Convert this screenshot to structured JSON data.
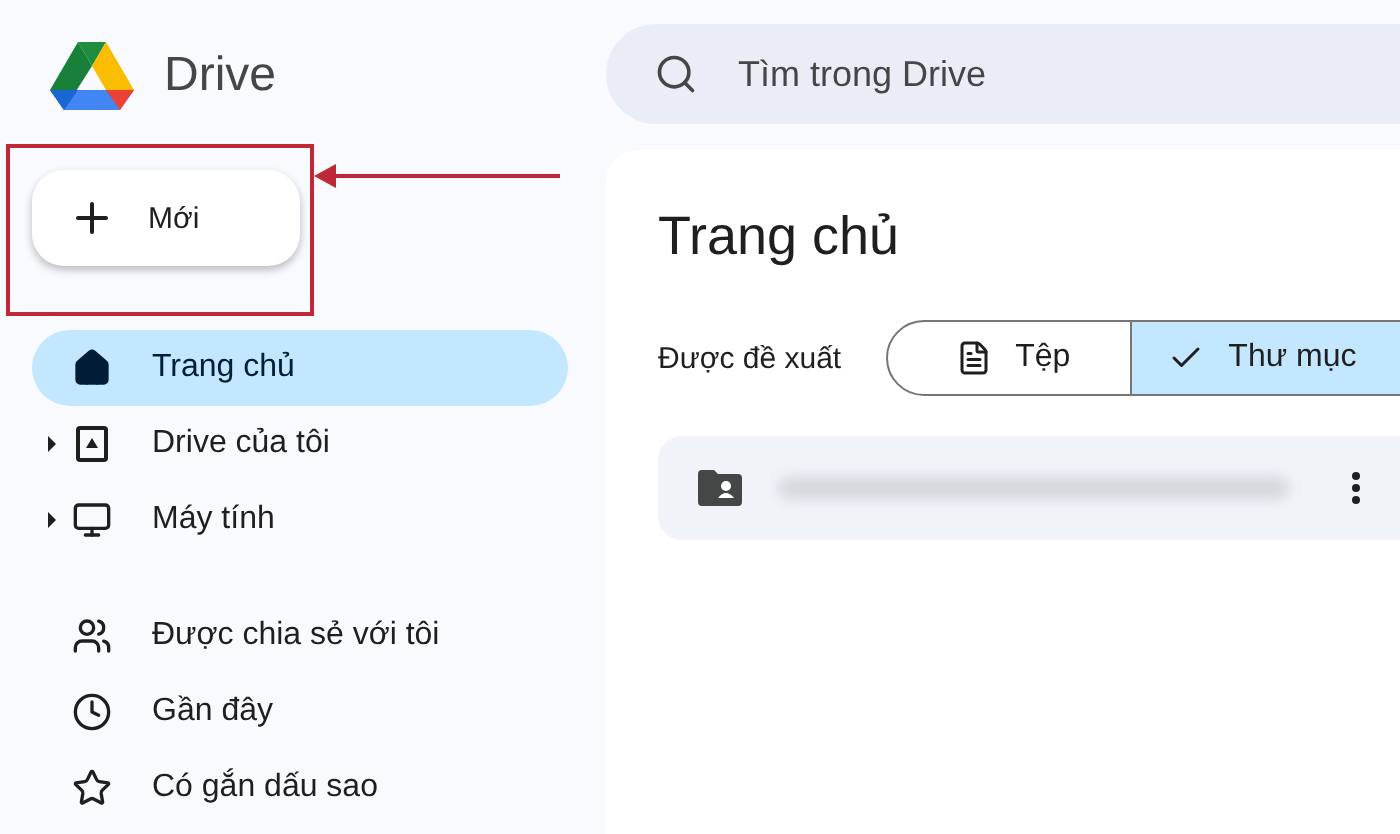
{
  "app": {
    "name": "Drive"
  },
  "new_button": {
    "label": "Mới"
  },
  "nav": [
    {
      "label": "Trang chủ",
      "selected": true,
      "expandable": false
    },
    {
      "label": "Drive của tôi",
      "selected": false,
      "expandable": true
    },
    {
      "label": "Máy tính",
      "selected": false,
      "expandable": true
    },
    {
      "label": "Được chia sẻ với tôi",
      "selected": false,
      "expandable": false
    },
    {
      "label": "Gần đây",
      "selected": false,
      "expandable": false
    },
    {
      "label": "Có gắn dấu sao",
      "selected": false,
      "expandable": false
    }
  ],
  "search": {
    "placeholder": "Tìm trong Drive"
  },
  "page_title": "Trang chủ",
  "filter": {
    "label": "Được đề xuất",
    "options": [
      {
        "label": "Tệp",
        "selected": false
      },
      {
        "label": "Thư mục",
        "selected": true
      }
    ]
  },
  "folders": [
    {
      "kind": "shared"
    }
  ]
}
